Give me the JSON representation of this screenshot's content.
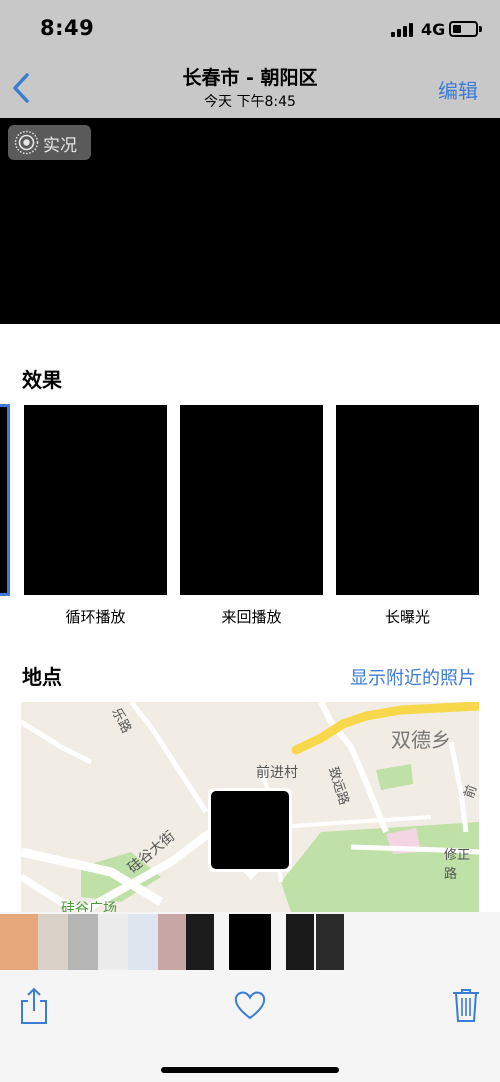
{
  "status_bar": {
    "time": "8:49",
    "network": "4G",
    "battery_level": 0.2
  },
  "nav": {
    "back_icon": "chevron-left-icon",
    "title": "长春市 - 朝阳区",
    "subtitle": "今天  下午8:45",
    "edit_label": "编辑"
  },
  "photo": {
    "live_label": "实况",
    "live_icon": "live-photo-icon"
  },
  "effects": {
    "title": "效果",
    "items": [
      {
        "label": "循环播放"
      },
      {
        "label": "来回播放"
      },
      {
        "label": "长曝光"
      }
    ]
  },
  "location": {
    "title": "地点",
    "nearby_link": "显示附近的照片",
    "map_labels": {
      "township": "双德乡",
      "village": "前进村",
      "avenue": "硅谷大街",
      "road_zhiyuan": "致远路",
      "road_xiuzheng": "修正路",
      "road_qianwei": "前卫",
      "road_top": "乐路",
      "plaza": "硅谷广场"
    }
  },
  "toolbar": {
    "share_icon": "share-icon",
    "favorite_icon": "heart-icon",
    "delete_icon": "trash-icon"
  },
  "colors": {
    "accent": "#3b7cd6",
    "bar_bg": "#c8c8c8",
    "map_road": "#f7d84a",
    "map_park": "#b9dfa0"
  }
}
